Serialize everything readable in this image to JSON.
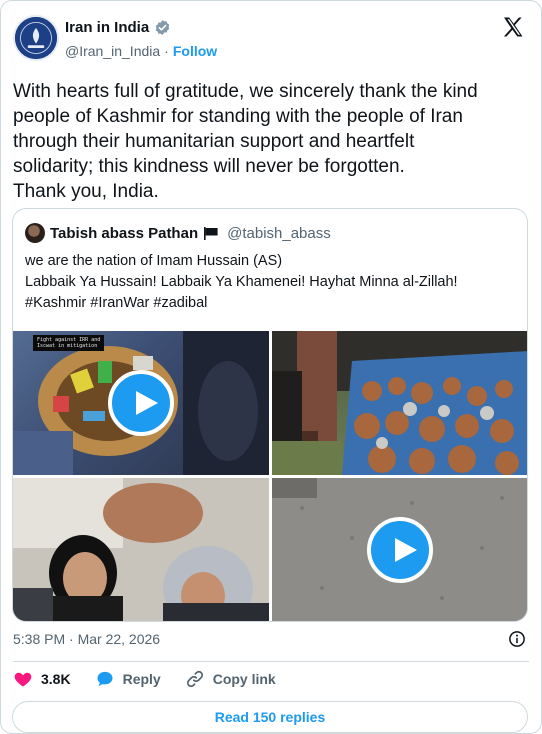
{
  "author": {
    "display_name": "Iran in India",
    "handle": "@Iran_in_India",
    "separator": "·",
    "follow_label": "Follow",
    "verified": true
  },
  "tweet": {
    "lines": [
      "With hearts full of gratitude, we sincerely thank the kind",
      "people of Kashmir for standing with the people of Iran",
      "through their humanitarian support and heartfelt",
      "solidarity; this kindness will never be forgotten.",
      "Thank you, India."
    ]
  },
  "quote": {
    "display_name": "Tabish abass Pathan",
    "handle": "@tabish_abass",
    "lines": [
      "we are the nation of Imam Hussain (AS)",
      "Labbaik Ya Hussain! Labbaik Ya Khamenei! Hayhat Minna al-Zillah!",
      "#Kashmir  #IranWar  #zadibal"
    ],
    "media": {
      "overlay_caption": "Fight against IRR and\nIscwat in mitigation",
      "tiles": [
        {
          "kind": "video"
        },
        {
          "kind": "image"
        },
        {
          "kind": "image"
        },
        {
          "kind": "video"
        }
      ]
    }
  },
  "meta": {
    "timestamp": "5:38 PM · Mar 22, 2026"
  },
  "actions": {
    "likes_count": "3.8K",
    "reply_label": "Reply",
    "copy_link_label": "Copy link"
  },
  "read_replies_label": "Read 150 replies",
  "colors": {
    "accent": "#1d9bf0",
    "like": "#f91880",
    "text": "#0f1419",
    "muted": "#536471",
    "border": "#cfd9de"
  },
  "icons": [
    "verified-badge-icon",
    "x-logo-icon",
    "flag-icon",
    "play-icon",
    "info-icon",
    "heart-icon",
    "reply-bubble-icon",
    "link-icon"
  ]
}
